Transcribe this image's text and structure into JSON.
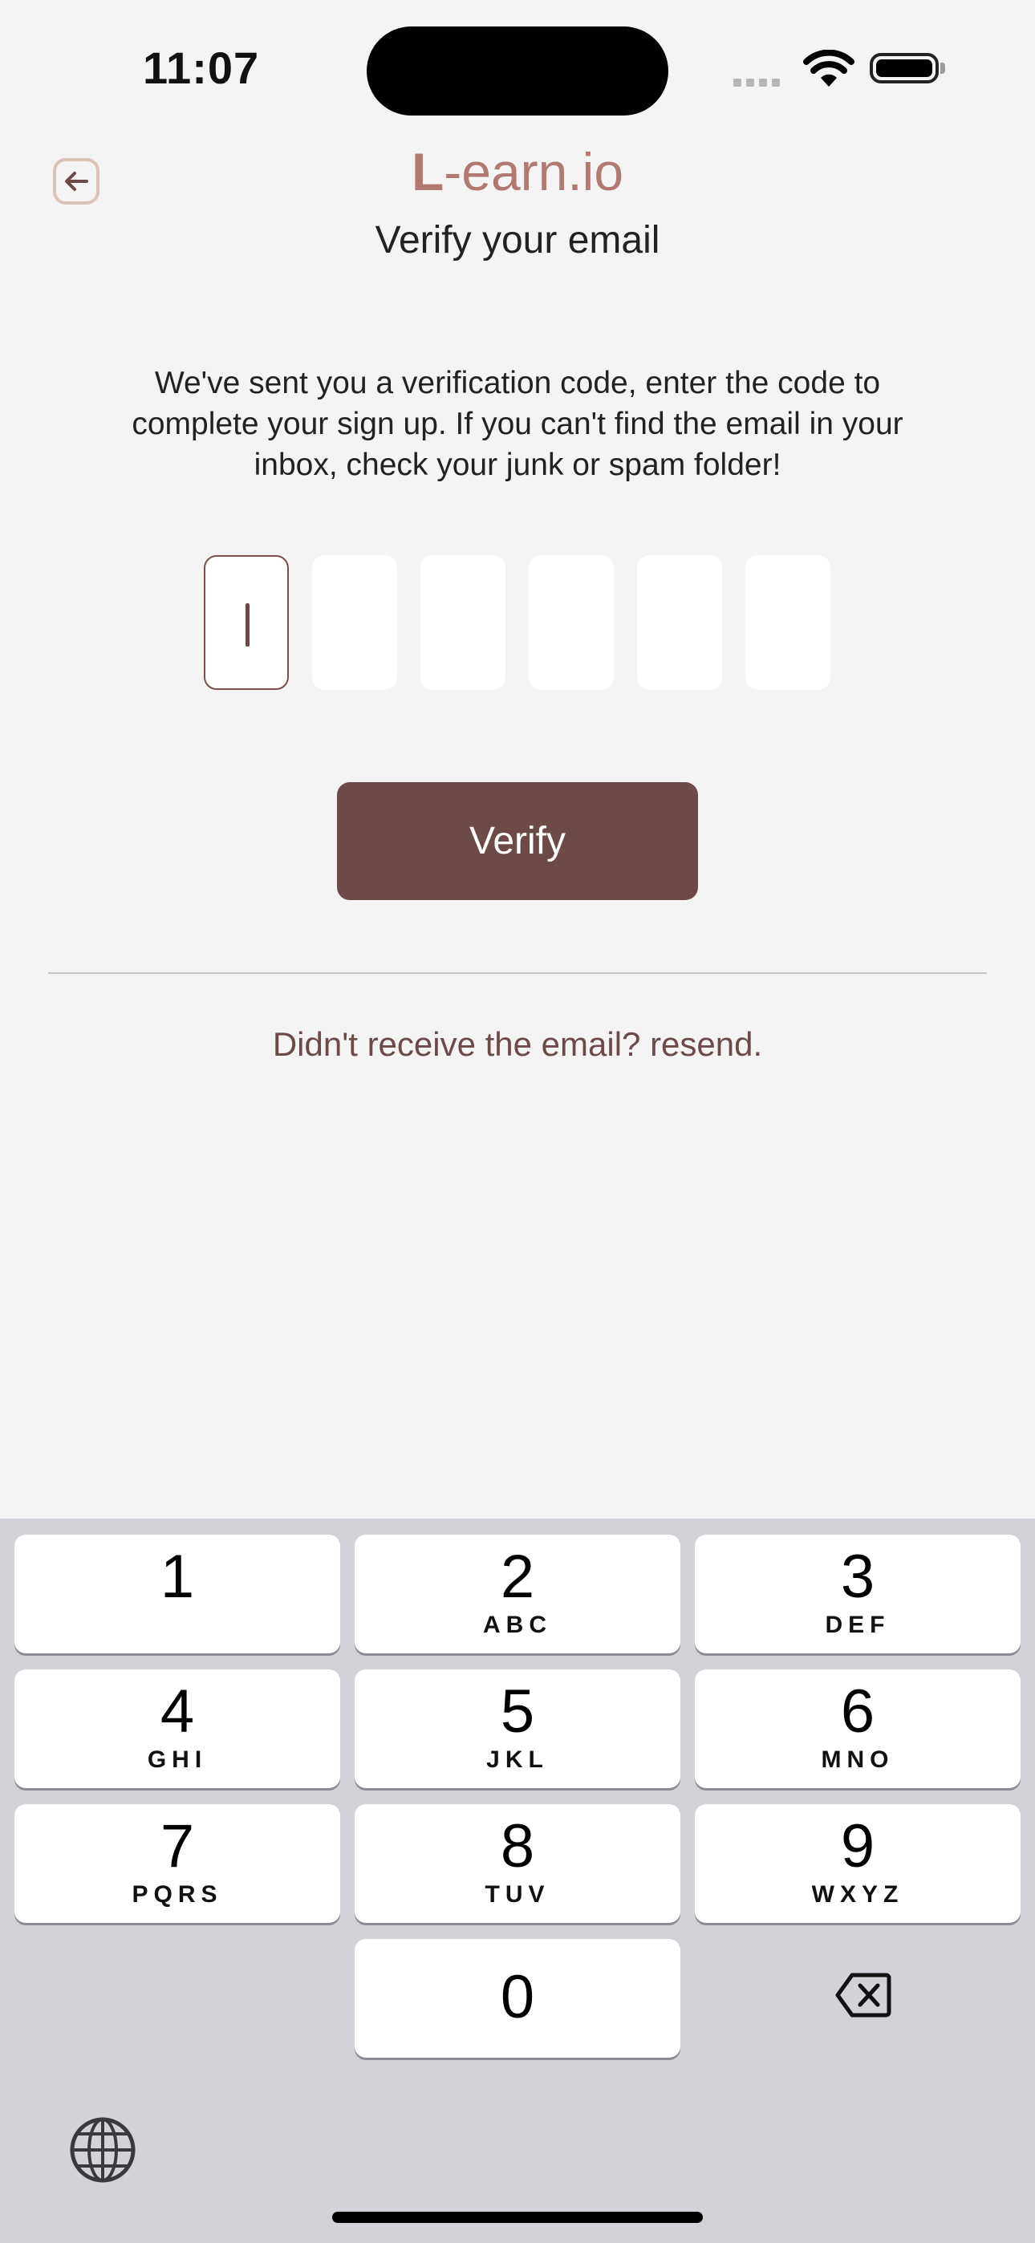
{
  "status_bar": {
    "time": "11:07"
  },
  "header": {
    "brand_prefix": "L",
    "brand_suffix": "-earn.io",
    "subtitle": "Verify your email"
  },
  "message": "We've sent you a verification code, enter the code to complete your sign up. If you can't find the email in your inbox, check your junk or spam folder!",
  "verify_label": "Verify",
  "resend_label": "Didn't receive the email? resend.",
  "keyboard": {
    "keys": [
      {
        "digit": "1",
        "letters": ""
      },
      {
        "digit": "2",
        "letters": "ABC"
      },
      {
        "digit": "3",
        "letters": "DEF"
      },
      {
        "digit": "4",
        "letters": "GHI"
      },
      {
        "digit": "5",
        "letters": "JKL"
      },
      {
        "digit": "6",
        "letters": "MNO"
      },
      {
        "digit": "7",
        "letters": "PQRS"
      },
      {
        "digit": "8",
        "letters": "TUV"
      },
      {
        "digit": "9",
        "letters": "WXYZ"
      },
      {
        "digit": "0",
        "letters": ""
      }
    ]
  },
  "colors": {
    "brand": "#b07a73",
    "primary_button": "#6b4a47",
    "background": "#f4f4f4",
    "keyboard_bg": "#d1d3d8"
  }
}
